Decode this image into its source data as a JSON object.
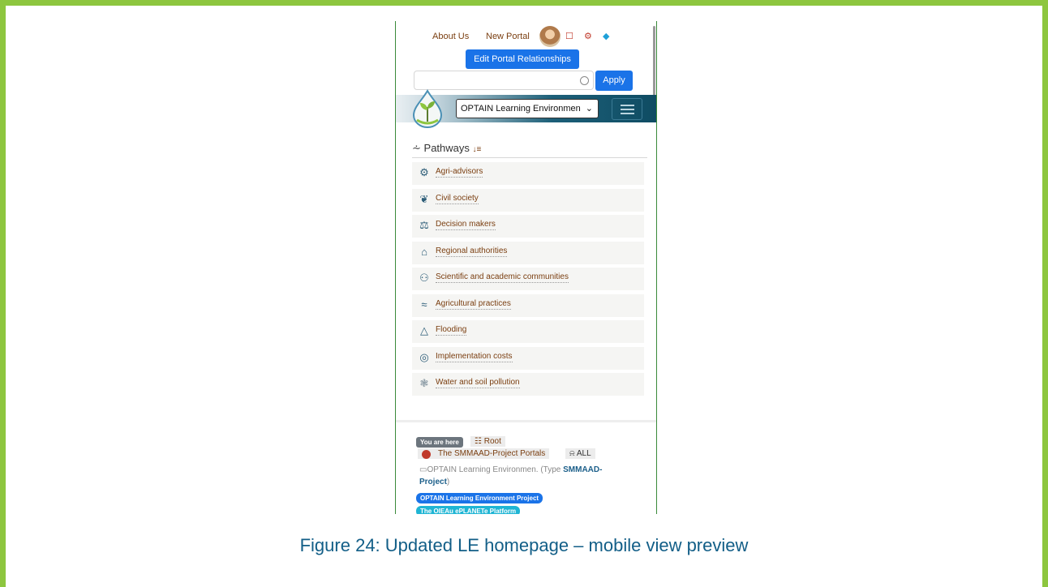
{
  "topnav": {
    "about": "About Us",
    "new_portal": "New Portal",
    "edit_btn": "Edit Portal Relationships"
  },
  "search": {
    "apply": "Apply"
  },
  "header": {
    "select_value": "OPTAIN Learning Environmen"
  },
  "pathways": {
    "title": "Pathways",
    "items": [
      {
        "label": "Agri-advisors",
        "icon": "tractor-icon"
      },
      {
        "label": "Civil society",
        "icon": "handshake-icon"
      },
      {
        "label": "Decision makers",
        "icon": "scales-icon"
      },
      {
        "label": "Regional authorities",
        "icon": "building-icon"
      },
      {
        "label": "Scientific and academic communities",
        "icon": "people-icon"
      },
      {
        "label": "Agricultural practices",
        "icon": "crops-icon"
      },
      {
        "label": "Flooding",
        "icon": "flood-icon"
      },
      {
        "label": "Implementation costs",
        "icon": "coins-icon"
      },
      {
        "label": "Water and soil pollution",
        "icon": "pollution-icon"
      }
    ]
  },
  "footer": {
    "you_are_here": "You are here",
    "root": "Root",
    "portal": "The SMMAAD-Project Portals",
    "all": "ALL",
    "type_prefix": "OPTAIN Learning Environmen. (Type ",
    "type_name": "SMMAAD-Project",
    "type_suffix": ")",
    "pill1": "OPTAIN Learning Environment Project",
    "pill2": "The OIEAu ePLANETe Platform"
  },
  "caption": "Figure 24: Updated LE homepage – mobile view preview",
  "colors": {
    "frame": "#8dc63f",
    "primary_button": "#1a73e8",
    "link": "#7a3e10",
    "caption": "#125e87"
  }
}
